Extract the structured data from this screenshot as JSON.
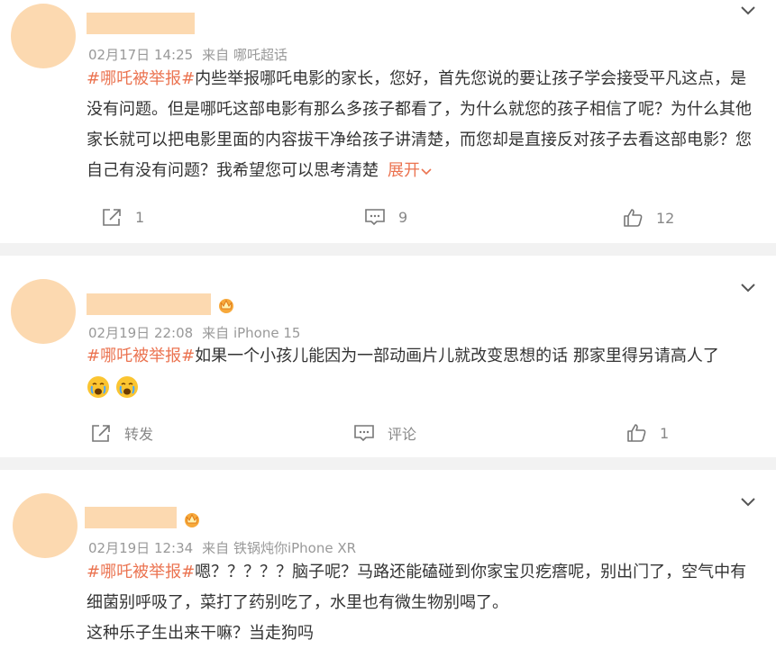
{
  "colors": {
    "accent": "#eb7350",
    "avatar": "#fcd9b0",
    "meta": "#999999",
    "text": "#333333",
    "separator": "#f2f2f2"
  },
  "posts": [
    {
      "time": "02月17日 14:25",
      "source": "来自 哪吒超话",
      "tag": "#哪吒被举报#",
      "text": "内些举报哪吒电影的家长，您好，首先您说的要让孩子学会接受平凡这点，是没有问题。但是哪吒这部电影有那么多孩子都看了，为什么就您的孩子相信了呢？为什么其他家长就可以把电影里面的内容拔干净给孩子讲清楚，而您却是直接反对孩子去看这部电影？您自己有没有问题？我希望您可以思考清楚",
      "more": "展开",
      "forward": "1",
      "comment": "9",
      "like": "12"
    },
    {
      "time": "02月19日 22:08",
      "source": "来自 iPhone 15",
      "tag": "#哪吒被举报#",
      "text": "如果一个小孩儿能因为一部动画片儿就改变思想的话 那家里得另请高人了",
      "emojis": [
        "crying-emoji",
        "crying-emoji"
      ],
      "forward": "转发",
      "comment": "评论",
      "like": "1"
    },
    {
      "time": "02月19日 12:34",
      "source": "来自 铁锅炖你iPhone XR",
      "tag": "#哪吒被举报#",
      "text": "嗯？？？？？脑子呢？马路还能磕碰到你家宝贝疙瘩呢，别出门了，空气中有细菌别呼吸了，菜打了药别吃了，水里也有微生物别喝了。",
      "text2": "这种乐子生出来干嘛？当走狗吗"
    }
  ]
}
